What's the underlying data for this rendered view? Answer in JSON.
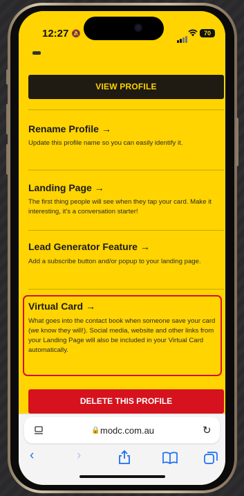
{
  "status_bar": {
    "time": "12:27",
    "battery": "70"
  },
  "profile_page": {
    "view_profile_label": "VIEW PROFILE",
    "sections": [
      {
        "title": "Rename Profile →",
        "description": "Update this profile name so you can easily identify it."
      },
      {
        "title": "Landing Page →",
        "description": "The first thing people will see when they tap your card. Make it interesting, it's a conversation starter!"
      },
      {
        "title": "Lead Generator Feature →",
        "description": "Add a subscribe button and/or popup to your landing page."
      },
      {
        "title": "Virtual Card →",
        "description": "What goes into the contact book when someone save your card (we know they will!). Social media, website and other links from your Landing Page will also be included in your Virtual Card automatically."
      }
    ],
    "delete_label": "DELETE THIS PROFILE"
  },
  "browser": {
    "url": "modc.com.au"
  },
  "colors": {
    "page_background": "#ffd400",
    "dark_button": "#1f1b12",
    "delete_button": "#d5121d",
    "highlight_border": "#d4102a",
    "toolbar_icons": "#1a6ef5"
  },
  "icons": [
    "reader-icon",
    "lock-icon",
    "reload-icon",
    "back-icon",
    "forward-icon",
    "share-icon",
    "bookmarks-icon",
    "tabs-icon"
  ]
}
